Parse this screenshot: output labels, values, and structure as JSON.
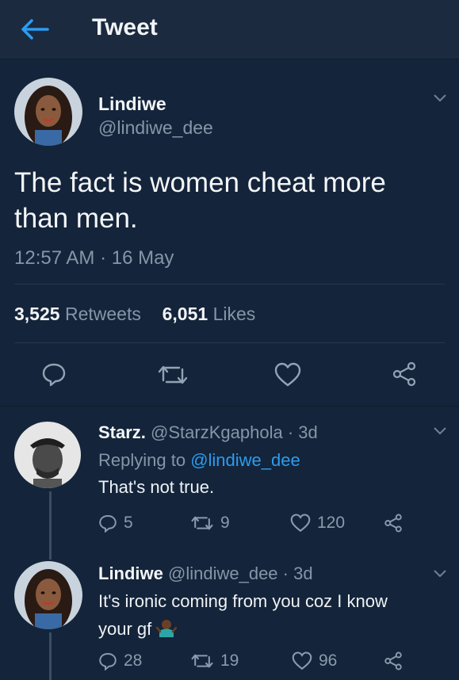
{
  "header": {
    "title": "Tweet"
  },
  "tweet": {
    "author_name": "Lindiwe",
    "author_handle": "@lindiwe_dee",
    "text_line1": "The fact is women cheat more",
    "text_line2": "than men.",
    "timestamp": "12:57 AM · 16 May",
    "retweets_count": "3,525",
    "retweets_label": "Retweets",
    "likes_count": "6,051",
    "likes_label": "Likes"
  },
  "replies": [
    {
      "name": "Starz.",
      "handle": "@StarzKgaphola",
      "time": "· 3d",
      "replying_prefix": "Replying to",
      "replying_to": "@lindiwe_dee",
      "text_line1": "That's not true.",
      "replies": "5",
      "retweets": "9",
      "likes": "120"
    },
    {
      "name": "Lindiwe",
      "handle": "@lindiwe_dee",
      "time": "· 3d",
      "text_line1": "It's ironic coming from you coz I know",
      "text_line2": "your gf",
      "replies": "28",
      "retweets": "19",
      "likes": "96"
    }
  ],
  "colors": {
    "background": "#14243a",
    "accent": "#2b9df0",
    "muted": "#8596a8"
  },
  "icons": [
    "back-arrow-icon",
    "chevron-down-icon",
    "reply-icon",
    "retweet-icon",
    "like-icon",
    "share-icon",
    "shrug-emoji-icon"
  ]
}
